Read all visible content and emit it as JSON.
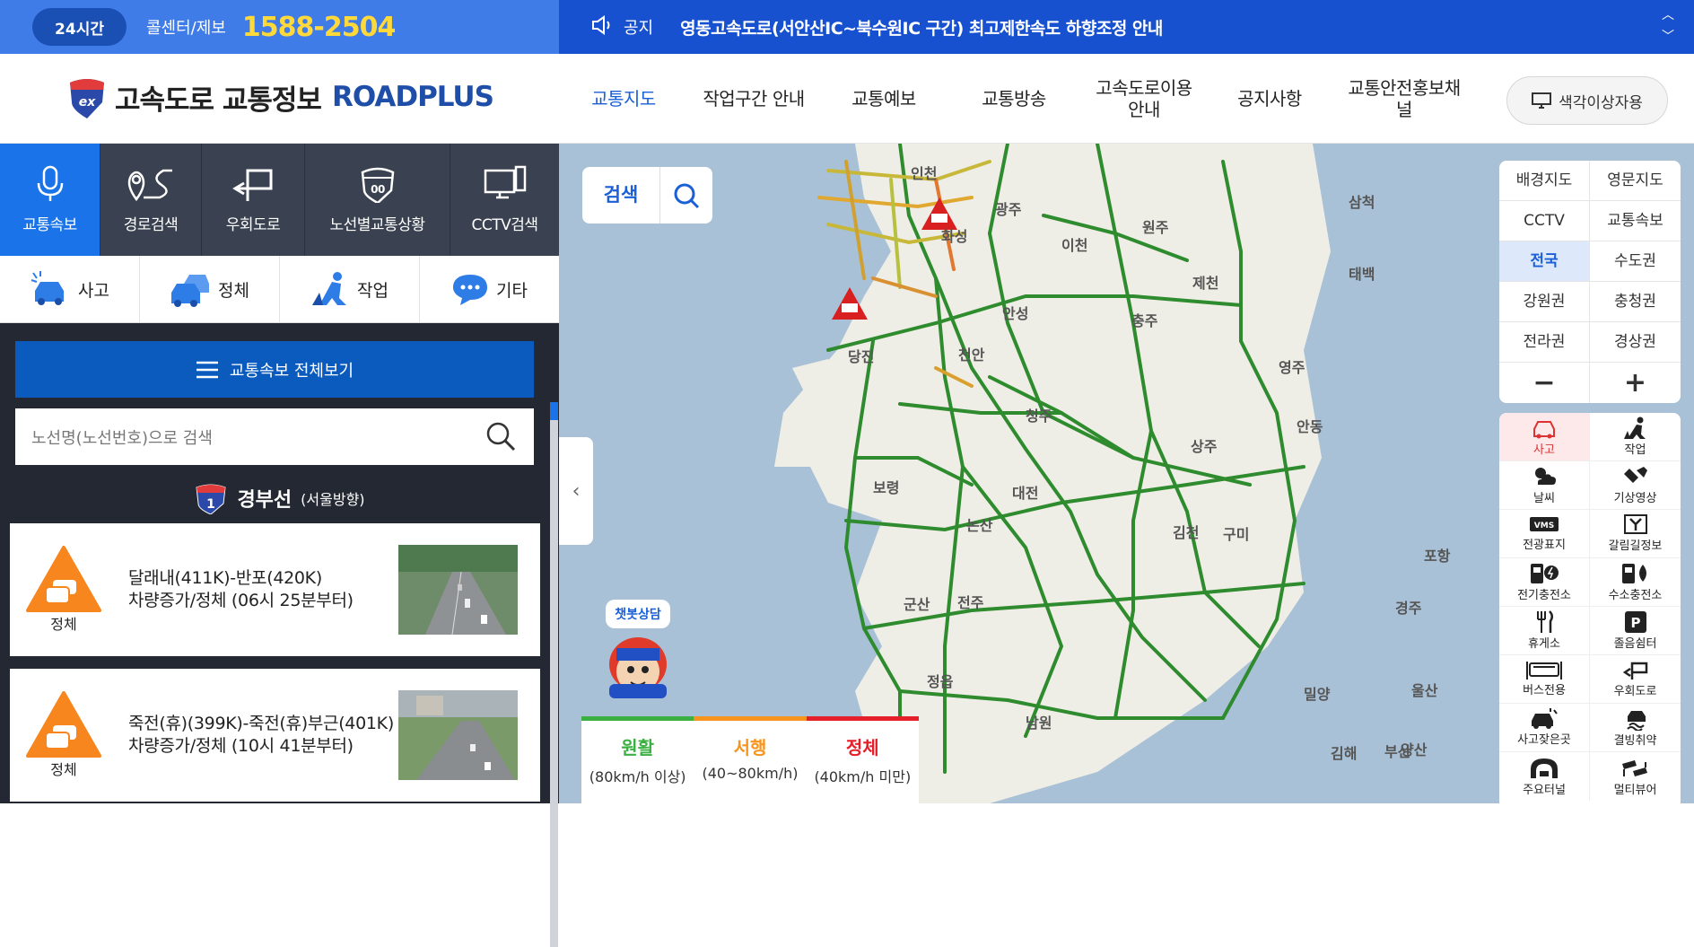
{
  "topbar": {
    "badge": "24시간",
    "callcenter": "콜센터/제보",
    "phone": "1588-2504",
    "notice_label": "공지",
    "notice_text": "영동고속도로(서안산IC~북수원IC 구간) 최고제한속도 하향조정 안내"
  },
  "header": {
    "logo_kr": "고속도로 교통정보",
    "logo_en": "ROADPLUS",
    "nav": [
      {
        "label": "교통지도",
        "active": true
      },
      {
        "label": "작업구간 안내"
      },
      {
        "label": "교통예보"
      },
      {
        "label": "교통방송"
      },
      {
        "label": "고속도로이용안내"
      },
      {
        "label": "공지사항"
      },
      {
        "label": "교통안전홍보채널"
      }
    ],
    "color_btn": "색각이상자용"
  },
  "sidebar": {
    "tabs": [
      "교통속보",
      "경로검색",
      "우회도로",
      "노선별교통상황",
      "CCTV검색"
    ],
    "categories": [
      "사고",
      "정체",
      "작업",
      "기타"
    ],
    "all_btn": "교통속보 전체보기",
    "search_placeholder": "노선명(노선번호)으로 검색",
    "route_no": "1",
    "route_name": "경부선",
    "route_dir": "(서울방향)",
    "cards": [
      {
        "status": "정체",
        "line1": "달래내(411K)-반포(420K)",
        "line2": "차량증가/정체 (06시 25분부터)"
      },
      {
        "status": "정체",
        "line1": "죽전(휴)(399K)-죽전(휴)부근(401K)",
        "line2": "차량증가/정체 (10시 41분부터)"
      }
    ]
  },
  "map": {
    "search_label": "검색",
    "chatbot": "챗봇상담",
    "legend": [
      {
        "title": "원활",
        "sub": "(80km/h 이상)",
        "color": "#3cb043"
      },
      {
        "title": "서행",
        "sub": "(40~80km/h)",
        "color": "#f7941d"
      },
      {
        "title": "정체",
        "sub": "(40km/h 미만)",
        "color": "#e5202a"
      }
    ],
    "layers": [
      "배경지도",
      "영문지도",
      "CCTV",
      "교통속보",
      "전국",
      "수도권",
      "강원권",
      "충청권",
      "전라권",
      "경상권",
      "−",
      "+"
    ],
    "icons": [
      "사고",
      "작업",
      "날씨",
      "기상영상",
      "전광표지",
      "갈림길정보",
      "전기충전소",
      "수소충전소",
      "휴게소",
      "졸음쉼터",
      "버스전용",
      "우회도로",
      "사고잦은곳",
      "결빙취약",
      "주요터널",
      "멀티뷰어"
    ],
    "vms_text": "VMS",
    "parking_text": "P",
    "cities": [
      "삼척",
      "태백",
      "제천",
      "충주",
      "영주",
      "안동",
      "상주",
      "김천",
      "구미",
      "포항",
      "경주",
      "울산",
      "밀양",
      "김해",
      "부산",
      "대전",
      "청주",
      "천안",
      "안성",
      "이천",
      "당진",
      "보령",
      "논산",
      "군산",
      "전주",
      "정읍",
      "남원",
      "양산",
      "원주",
      "인천",
      "광주",
      "화성"
    ]
  }
}
